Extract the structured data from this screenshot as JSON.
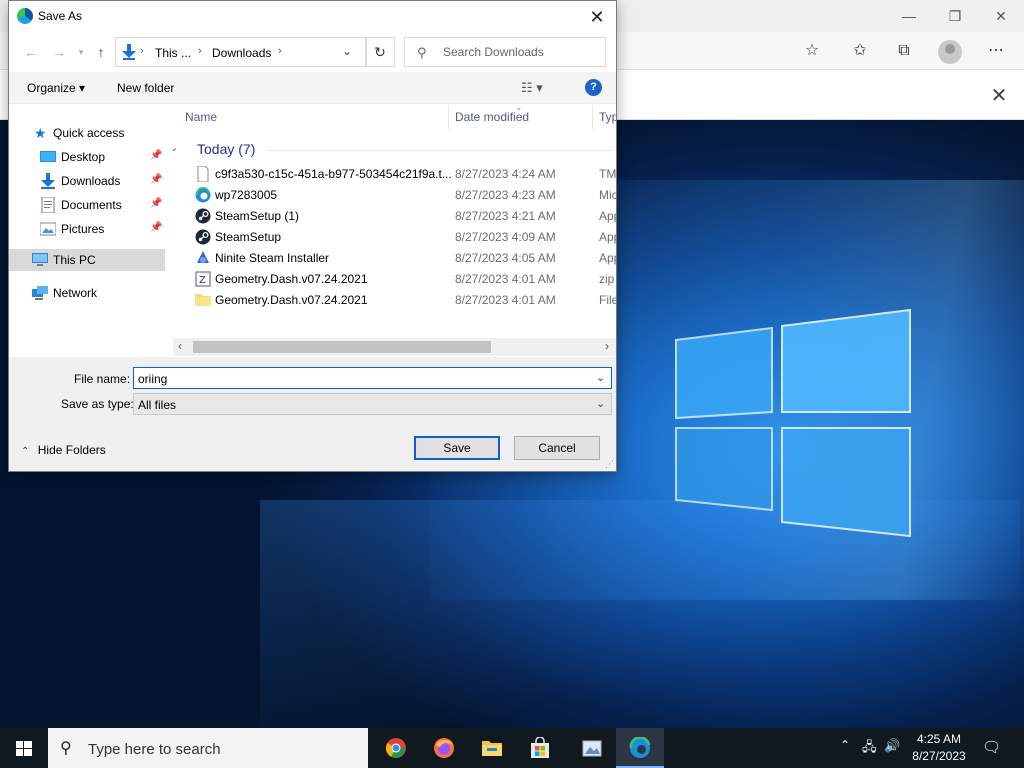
{
  "dialog": {
    "title": "Save As",
    "close_label": "✕",
    "breadcrumb": [
      "This ...",
      "Downloads"
    ],
    "search_placeholder": "Search Downloads",
    "organize_label": "Organize ▾",
    "new_folder_label": "New folder",
    "help_label": "?",
    "nav_pane": [
      {
        "label": "Quick access",
        "icon": "star-icon"
      },
      {
        "label": "Desktop",
        "icon": "desktop-folder-icon",
        "pinned": true
      },
      {
        "label": "Downloads",
        "icon": "download-arrow-icon",
        "pinned": true
      },
      {
        "label": "Documents",
        "icon": "documents-icon",
        "pinned": true
      },
      {
        "label": "Pictures",
        "icon": "pictures-icon",
        "pinned": true
      },
      {
        "label": "This PC",
        "icon": "computer-icon",
        "selected": true
      },
      {
        "label": "Network",
        "icon": "network-icon"
      }
    ],
    "columns": [
      "Name",
      "Date modified",
      "Type"
    ],
    "group_label": "Today (7)",
    "files": [
      {
        "name": "c9f3a530-c15c-451a-b977-503454c21f9a.t...",
        "date": "8/27/2023 4:24 AM",
        "type": "TMP",
        "icon": "blank-file-icon"
      },
      {
        "name": "wp7283005",
        "date": "8/27/2023 4:23 AM",
        "type": "Micro",
        "icon": "edge-file-icon"
      },
      {
        "name": "SteamSetup (1)",
        "date": "8/27/2023 4:21 AM",
        "type": "Appli",
        "icon": "steam-icon"
      },
      {
        "name": "SteamSetup",
        "date": "8/27/2023 4:09 AM",
        "type": "Appli",
        "icon": "steam-icon"
      },
      {
        "name": "Ninite Steam Installer",
        "date": "8/27/2023 4:05 AM",
        "type": "Appli",
        "icon": "ninite-icon"
      },
      {
        "name": "Geometry.Dash.v07.24.2021",
        "date": "8/27/2023 4:01 AM",
        "type": "zip A",
        "icon": "zip-icon"
      },
      {
        "name": "Geometry.Dash.v07.24.2021",
        "date": "8/27/2023 4:01 AM",
        "type": "File f",
        "icon": "folder-icon"
      }
    ],
    "file_name_label": "File name:",
    "file_name_value": "oriing",
    "save_type_label": "Save as type:",
    "save_type_value": "All files",
    "hide_folders_label": "Hide Folders",
    "save_label": "Save",
    "cancel_label": "Cancel"
  },
  "taskbar": {
    "search_placeholder": "Type here to search",
    "time": "4:25 AM",
    "date": "8/27/2023",
    "apps": [
      "chrome-icon",
      "firefox-icon",
      "file-explorer-icon",
      "store-icon",
      "photos-icon",
      "edge-icon"
    ]
  },
  "colors": {
    "accent": "#0a63c9",
    "taskbar": "#101820",
    "group_header": "#1e3287"
  }
}
